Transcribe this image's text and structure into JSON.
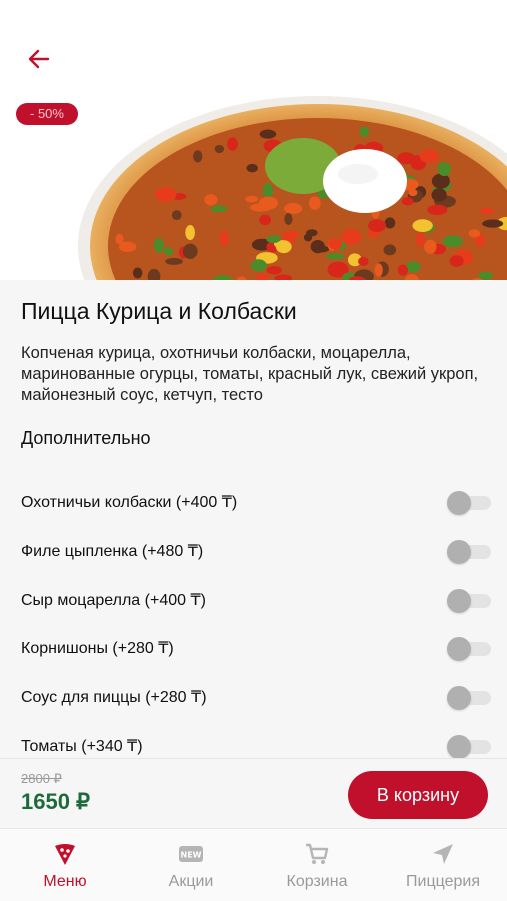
{
  "discount_badge": "- 50%",
  "product": {
    "title": "Пицца Курица и Колбаски",
    "description": "Копченая курица, охотничьи колбаски, моцарелла, маринованные огурцы, томаты, красный лук, свежий укроп, майонезный соус, кетчуп, тесто"
  },
  "extras": {
    "title": "Дополнительно",
    "items": [
      {
        "label": "Охотничьи колбаски (+400 ₸)",
        "checked": false
      },
      {
        "label": "Филе цыпленка (+480 ₸)",
        "checked": false
      },
      {
        "label": "Сыр моцарелла (+400 ₸)",
        "checked": false
      },
      {
        "label": "Корнишоны (+280 ₸)",
        "checked": false
      },
      {
        "label": "Соус для пиццы (+280 ₸)",
        "checked": false
      },
      {
        "label": "Томаты (+340 ₸)",
        "checked": false
      }
    ]
  },
  "pricing": {
    "old_price": "2800 ₽",
    "price": "1650 ₽",
    "cart_button": "В корзину"
  },
  "tabbar": {
    "items": [
      {
        "label": "Меню",
        "icon": "pizza-slice-icon",
        "active": true
      },
      {
        "label": "Акции",
        "icon": "new-badge-icon",
        "active": false
      },
      {
        "label": "Корзина",
        "icon": "cart-icon",
        "active": false
      },
      {
        "label": "Пиццерия",
        "icon": "location-arrow-icon",
        "active": false
      }
    ]
  },
  "colors": {
    "accent": "#c0102c",
    "price_green": "#1d6a3b",
    "inactive": "#9a9a9a"
  }
}
